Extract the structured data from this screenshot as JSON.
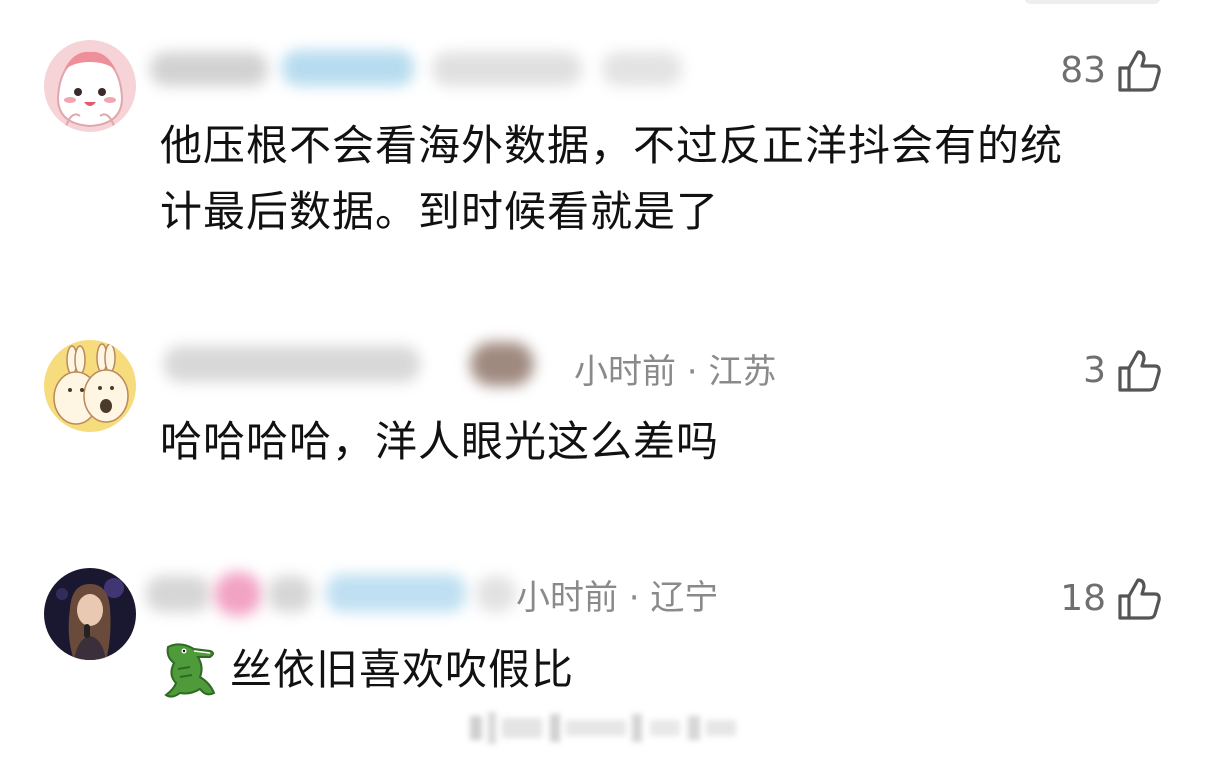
{
  "comments": [
    {
      "id": 1,
      "like_count": "83",
      "meta_visible": "",
      "content_lines": [
        "他压根不会看海外数据，不过反正洋抖会有的统",
        "计最后数据。到时候看就是了"
      ]
    },
    {
      "id": 2,
      "like_count": "3",
      "meta_visible": "小时前 · 江苏",
      "content_lines": [
        "哈哈哈哈，洋人眼光这么差吗"
      ]
    },
    {
      "id": 3,
      "like_count": "18",
      "meta_visible": "小时前 · 辽宁",
      "content_lines": [
        "丝依旧喜欢吹假比"
      ]
    }
  ],
  "icons": {
    "like": "thumbs-up-icon",
    "emoji": "crocodile-emoji-icon"
  },
  "colors": {
    "meta_text": "#8a8a8a",
    "like_count": "#6f6f6f",
    "content_text": "#111111"
  }
}
